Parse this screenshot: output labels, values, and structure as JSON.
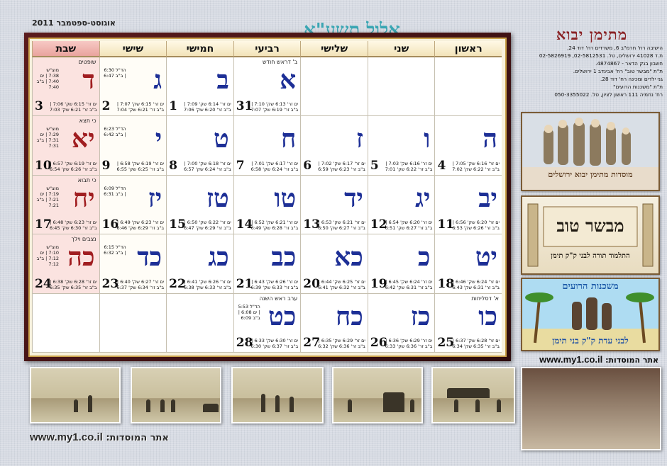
{
  "header": {
    "hebrew_month": "אלול תשע\"א",
    "gregorian_months": "אוגוסט-ספטמבר 2011"
  },
  "weekdays": [
    "ראשון",
    "שני",
    "שלישי",
    "רביעי",
    "חמישי",
    "שישי",
    "שבת"
  ],
  "weeks": [
    [
      {
        "heb": "",
        "greg": "",
        "note": "",
        "times": ""
      },
      {
        "heb": "",
        "greg": "",
        "note": "",
        "times": ""
      },
      {
        "heb": "",
        "greg": "",
        "note": "",
        "times": ""
      },
      {
        "heb": "א",
        "greg": "31",
        "note": "ב' דראש חודש",
        "times": "ים זר' 6:13 שק' 7:10 | ב\"ב זר' 6:19 שק' 7:07"
      },
      {
        "heb": "ב",
        "greg": "1",
        "note": "",
        "times": "ים זר' 6:14 שק' 7:09 | ב\"ב זר' 6:20 שק' 7:06"
      },
      {
        "heb": "ג",
        "greg": "2",
        "note": "",
        "times": "ים זר' 6:15 שק' 7:07 | ב\"ב זר' 6:21 שק' 7:04",
        "z": "הד\"ל 6:30 | ב\"ב 6:47"
      },
      {
        "heb": "ד",
        "greg": "3",
        "note": "שופטים",
        "times": "ים זר' 6:15 שק' 7:06 | ב\"ב זר' 6:21 שק' 7:03",
        "z": "מוצ\"ש 7:38 | ים 7:40 | ב\"ב 7:40"
      }
    ],
    [
      {
        "heb": "ה",
        "greg": "4",
        "note": "",
        "times": "ים זר' 6:16 שק' 7:05 | ב\"ב זר' 6:22 שק' 7:02"
      },
      {
        "heb": "ו",
        "greg": "5",
        "note": "",
        "times": "ים זר' 6:16 שק' 7:03 | ב\"ב זר' 6:22 שק' 7:01"
      },
      {
        "heb": "ז",
        "greg": "6",
        "note": "",
        "times": "ים זר' 6:17 שק' 7:02 | ב\"ב זר' 6:23 שק' 6:59"
      },
      {
        "heb": "ח",
        "greg": "7",
        "note": "",
        "times": "ים זר' 6:17 שק' 7:01 | ב\"ב זר' 6:24 שק' 6:58"
      },
      {
        "heb": "ט",
        "greg": "8",
        "note": "",
        "times": "ים זר' 6:18 שק' 7:00 | ב\"ב זר' 6:24 שק' 6:57"
      },
      {
        "heb": "י",
        "greg": "9",
        "note": "",
        "times": "ים זר' 6:19 שק' 6:58 | ב\"ב זר' 6:25 שק' 6:55",
        "z": "הד\"ל 6:23 | ב\"ב 6:42"
      },
      {
        "heb": "יא",
        "greg": "10",
        "note": "כי תצא",
        "times": "ים זר' 6:19 שק' 6:57 | ב\"ב זר' 6:26 שק' 6:54",
        "z": "מוצ\"ש 7:29 | ים 7:31 | ב\"ב 7:31"
      }
    ],
    [
      {
        "heb": "יב",
        "greg": "11",
        "note": "",
        "times": "ים זר' 6:20 שק' 6:56 | ב\"ב זר' 6:26 שק' 6:53"
      },
      {
        "heb": "יג",
        "greg": "12",
        "note": "",
        "times": "ים זר' 6:20 שק' 6:54 | ב\"ב זר' 6:27 שק' 6:51"
      },
      {
        "heb": "יד",
        "greg": "13",
        "note": "",
        "times": "ים זר' 6:21 שק' 6:53 | ב\"ב זר' 6:27 שק' 6:50"
      },
      {
        "heb": "טו",
        "greg": "14",
        "note": "",
        "times": "ים זר' 6:21 שק' 6:52 | ב\"ב זר' 6:28 שק' 6:49"
      },
      {
        "heb": "טז",
        "greg": "15",
        "note": "",
        "times": "ים זר' 6:22 שק' 6:50 | ב\"ב זר' 6:29 שק' 6:47"
      },
      {
        "heb": "יז",
        "greg": "16",
        "note": "",
        "times": "ים זר' 6:23 שק' 6:49 | ב\"ב זר' 6:29 שק' 6:46",
        "z": "הד\"ל 6:09 | ב\"ב 6:31"
      },
      {
        "heb": "יח",
        "greg": "17",
        "note": "כי תבוא",
        "times": "ים זר' 6:23 שק' 6:48 | ב\"ב זר' 6:30 שק' 6:45",
        "z": "מוצ\"ש 7:19 | ים 7:21 | ב\"ב 7:21"
      }
    ],
    [
      {
        "heb": "יט",
        "greg": "18",
        "note": "",
        "times": "ים זר' 6:24 שק' 6:46 | ב\"ב זר' 6:31 שק' 6:43"
      },
      {
        "heb": "כ",
        "greg": "19",
        "note": "",
        "times": "ים זר' 6:24 שק' 6:45 | ב\"ב זר' 6:31 שק' 6:42"
      },
      {
        "heb": "כא",
        "greg": "20",
        "note": "",
        "times": "ים זר' 6:25 שק' 6:44 | ב\"ב זר' 6:32 שק' 6:41"
      },
      {
        "heb": "כב",
        "greg": "21",
        "note": "",
        "times": "ים זר' 6:26 שק' 6:43 | ב\"ב זר' 6:33 שק' 6:39"
      },
      {
        "heb": "כג",
        "greg": "22",
        "note": "",
        "times": "ים זר' 6:26 שק' 6:41 | ב\"ב זר' 6:33 שק' 6:38"
      },
      {
        "heb": "כד",
        "greg": "23",
        "note": "",
        "times": "ים זר' 6:27 שק' 6:40 | ב\"ב זר' 6:34 שק' 6:37",
        "z": "הד\"ל 6:15 | ב\"ב 6:32"
      },
      {
        "heb": "כה",
        "greg": "24",
        "note": "נצבים וילך",
        "times": "ים זר' 6:28 שק' 6:38 | ב\"ב זר' 6:35 שק' 6:35",
        "z": "מוצ\"ש 7:10 | ים 7:12 | ב\"ב 7:12"
      }
    ],
    [
      {
        "heb": "כו",
        "greg": "25",
        "note": "א' דסליחות",
        "times": "ים זר' 6:28 שק' 6:37 | ב\"ב זר' 6:35 שק' 6:34"
      },
      {
        "heb": "כז",
        "greg": "26",
        "note": "",
        "times": "ים זר' 6:29 שק' 6:36 | ב\"ב זר' 6:36 שק' 6:33"
      },
      {
        "heb": "כח",
        "greg": "27",
        "note": "",
        "times": "ים זר' 6:29 שק' 6:35 | ב\"ב זר' 6:36 שק' 6:32"
      },
      {
        "heb": "כט",
        "greg": "28",
        "note": "ערב ראש השנה",
        "times": "ים זר' 6:30 שק' 6:33 | ב\"ב זר' 6:37 שק' 6:30",
        "z": "הד\"ל 5:53 | ים 6:08 | ב\"ב 6:09"
      },
      {
        "heb": "",
        "greg": "",
        "note": "",
        "times": ""
      },
      {
        "heb": "",
        "greg": "",
        "note": "",
        "times": ""
      },
      {
        "heb": "",
        "greg": "",
        "note": "",
        "times": ""
      }
    ]
  ],
  "org": {
    "title": "מתימן יבוא",
    "lines": [
      "הישיבה רח' חרמ\"ב 6, משרדים רח' דוד 24,",
      "ת.ד 41028 ירושלים, טל. 02-5812531, 02-5826919",
      "חשבון בנק הדאר - 4874867.",
      "ת\"ת \"מבשר טוב\" רח' אבינדב 1 ירושלים.",
      "גני ילדים ומכינה רח' דוד 28.",
      "ת\"ת \"משכנות הרועים\"",
      "רח' נחמיה 111 ראשון לציון, טל. 050-3355022"
    ]
  },
  "ads": {
    "ad1": "מוסדות מתימן יבוא ירושלים",
    "ad2_title": "מבשר טוב",
    "ad2_sub": "התלמוד תורה לבני ק\"ק תימן",
    "ad3_title": "משכנות הרועים",
    "ad3_sub": "לבני עדת ק\"ק בני תימן"
  },
  "site": {
    "label": "אתר המוסדות:",
    "url": "www.my1.co.il"
  }
}
